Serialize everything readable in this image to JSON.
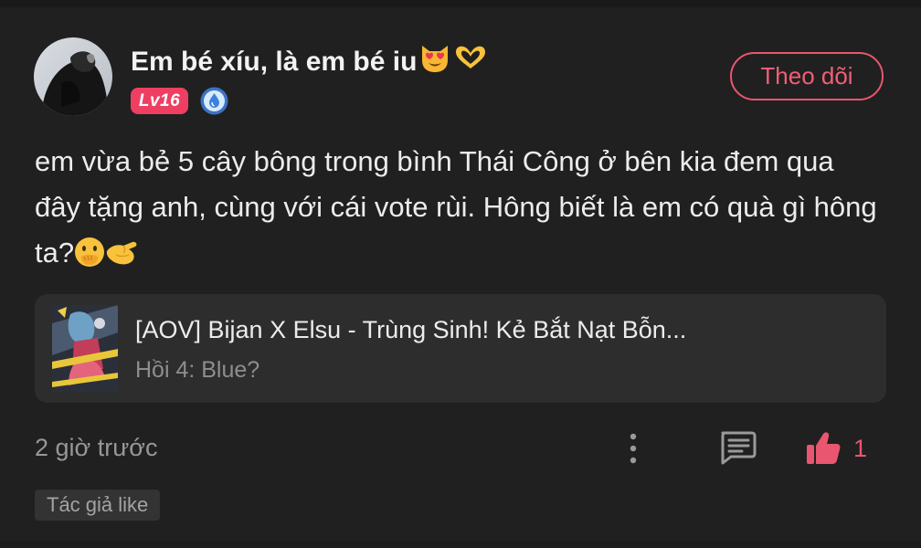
{
  "comment": {
    "username": "Em bé xíu, là em bé iu",
    "username_emojis": [
      "smiling-cat-heart-eyes-emoji",
      "heart-hands-emoji"
    ],
    "level_badge": "Lv16",
    "badge_icon": "water-drop-badge-icon",
    "follow_label": "Theo dõi",
    "text": "em vừa bẻ 5 cây bông trong bình Thái Công ở bên kia đem qua đây tặng anh, cùng với cái vote rùi. Hông biết là em có quà gì hông ta?",
    "text_emojis": [
      "face-with-hand-over-mouth-emoji",
      "pinching-hand-emoji"
    ],
    "time": "2 giờ trước",
    "likes": "1",
    "author_tag": "Tác giả like"
  },
  "story": {
    "title": "[AOV] Bijan X Elsu - Trùng Sinh! Kẻ Bắt Nạt Bỗn...",
    "chapter": "Hồi 4: Blue?"
  },
  "icons": {
    "more": "more-vertical-icon",
    "reply": "comment-reply-icon",
    "like": "thumbs-up-icon"
  },
  "colors": {
    "background": "#202020",
    "card": "#2d2d2d",
    "accent": "#e9566f",
    "level_badge": "#ee3f63",
    "secondary_text": "#979797"
  }
}
